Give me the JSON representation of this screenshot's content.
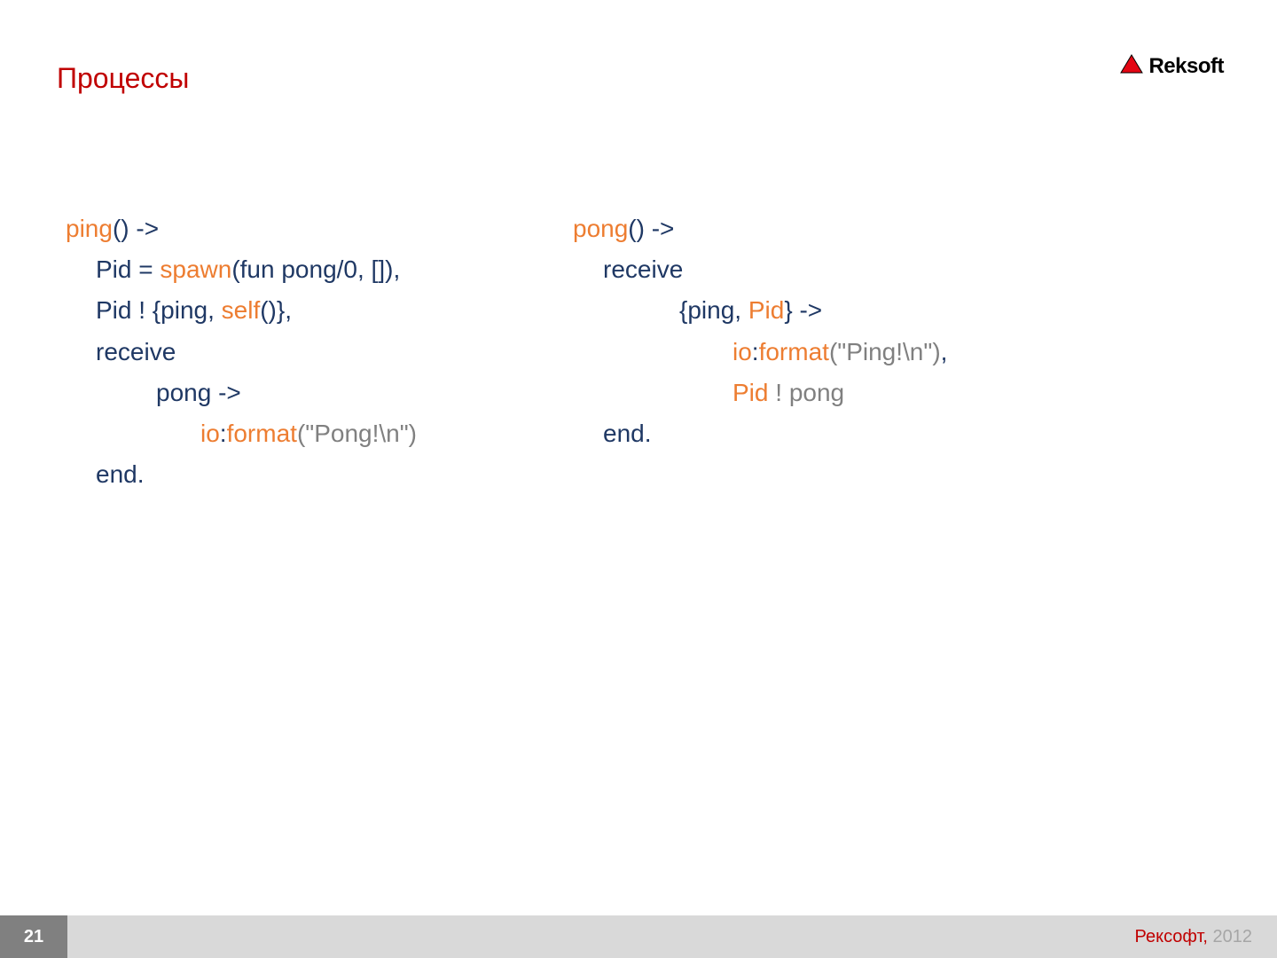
{
  "header": {
    "title": "Процессы",
    "logo_text": "Reksoft"
  },
  "left": {
    "l1_a": "ping",
    "l1_b": "() ->",
    "l2_a": "Pid = ",
    "l2_b": "spawn",
    "l2_c": "(fun pong/0, []),",
    "l3_a": "Pid ! {ping, ",
    "l3_b": "self",
    "l3_c": "()},",
    "l4": "receive",
    "l5": "pong ->",
    "l6_a": "io",
    "l6_b": ":",
    "l6_c": "format",
    "l6_d": "(\"Pong!\\n\")",
    "l7_a": "end",
    "l7_b": "."
  },
  "right": {
    "l1_a": "pong",
    "l1_b": "() ->",
    "l2": "receive",
    "l3_a": "{ping, ",
    "l3_b": "Pid",
    "l3_c": "} ->",
    "l4_a": "io",
    "l4_b": ":",
    "l4_c": "format",
    "l4_d": "(\"Ping!\\n\")",
    "l4_e": ",",
    "l5_a": "Pid",
    "l5_b": " ! ",
    "l5_c": "pong",
    "l6_a": "end",
    "l6_b": "."
  },
  "footer": {
    "page": "21",
    "company": "Рексофт,",
    "year": " 2012"
  }
}
